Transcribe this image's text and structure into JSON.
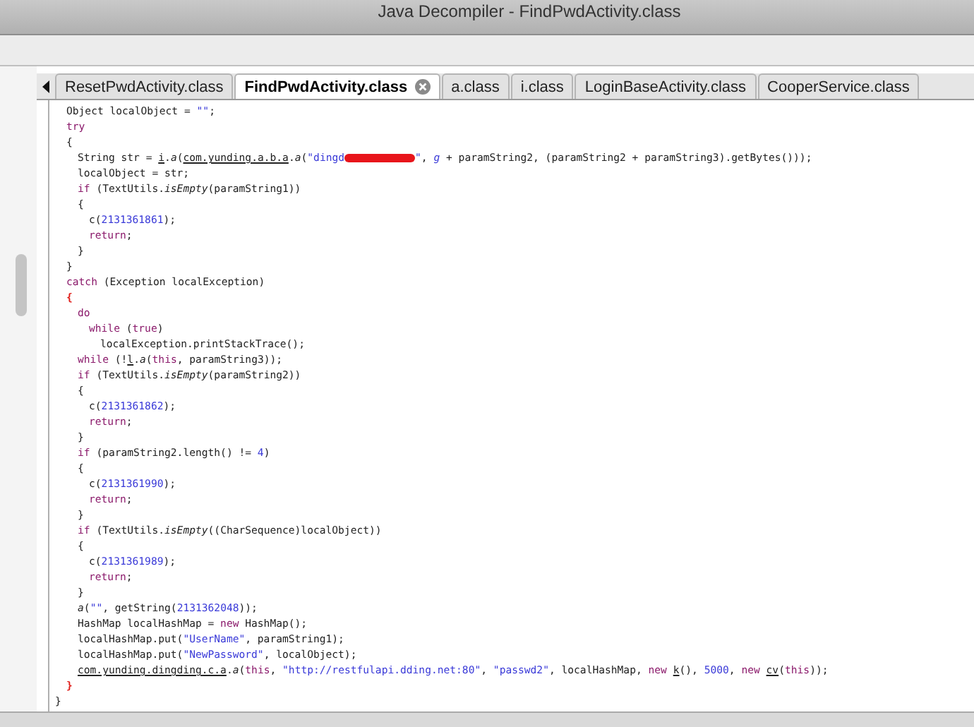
{
  "window": {
    "title": "Java Decompiler - FindPwdActivity.class"
  },
  "tabs": [
    {
      "label": "ResetPwdActivity.class",
      "selected": false
    },
    {
      "label": "FindPwdActivity.class",
      "selected": true
    },
    {
      "label": "a.class",
      "selected": false
    },
    {
      "label": "i.class",
      "selected": false
    },
    {
      "label": "LoginBaseActivity.class",
      "selected": false
    },
    {
      "label": "CooperService.class",
      "selected": false
    }
  ],
  "code": [
    {
      "children": [
        {
          "tokens": [
            {
              "kind": "plain",
              "text": "Object localObject = "
            },
            {
              "kind": "literal",
              "text": "\"\""
            },
            {
              "kind": "plain",
              "text": ";"
            }
          ]
        },
        {
          "tokens": [
            {
              "kind": "keyword",
              "text": "try"
            }
          ]
        },
        {
          "tokens": [
            {
              "kind": "plain",
              "text": "{"
            }
          ],
          "children": [
            {
              "tokens": [
                {
                  "kind": "plain",
                  "text": "String str = "
                },
                {
                  "kind": "link",
                  "text": "i"
                },
                {
                  "kind": "plain",
                  "text": "."
                },
                {
                  "kind": "method",
                  "text": "a"
                },
                {
                  "kind": "plain",
                  "text": "("
                },
                {
                  "kind": "link",
                  "text": "com.yunding.a.b.a"
                },
                {
                  "kind": "plain",
                  "text": "."
                },
                {
                  "kind": "method",
                  "text": "a"
                },
                {
                  "kind": "plain",
                  "text": "("
                },
                {
                  "kind": "literal",
                  "text": "\"dingd"
                },
                {
                  "kind": "redaction"
                },
                {
                  "kind": "literal",
                  "text": "\""
                },
                {
                  "kind": "plain",
                  "text": ", "
                },
                {
                  "kind": "field",
                  "text": "g"
                },
                {
                  "kind": "plain",
                  "text": " + paramString2, (paramString2 + paramString3).getBytes()));"
                }
              ]
            },
            {
              "tokens": [
                {
                  "kind": "plain",
                  "text": "localObject = str;"
                }
              ]
            },
            {
              "tokens": [
                {
                  "kind": "keyword",
                  "text": "if"
                },
                {
                  "kind": "plain",
                  "text": " (TextUtils."
                },
                {
                  "kind": "method",
                  "text": "isEmpty"
                },
                {
                  "kind": "plain",
                  "text": "(paramString1))"
                }
              ]
            },
            {
              "tokens": [
                {
                  "kind": "plain",
                  "text": "{"
                }
              ],
              "children": [
                {
                  "tokens": [
                    {
                      "kind": "plain",
                      "text": "c("
                    },
                    {
                      "kind": "literal",
                      "text": "2131361861"
                    },
                    {
                      "kind": "plain",
                      "text": ");"
                    }
                  ]
                },
                {
                  "tokens": [
                    {
                      "kind": "keyword",
                      "text": "return"
                    },
                    {
                      "kind": "plain",
                      "text": ";"
                    }
                  ]
                }
              ]
            },
            {
              "tokens": [
                {
                  "kind": "plain",
                  "text": "}"
                }
              ]
            }
          ]
        },
        {
          "tokens": [
            {
              "kind": "plain",
              "text": "}"
            }
          ]
        },
        {
          "tokens": [
            {
              "kind": "keyword",
              "text": "catch"
            },
            {
              "kind": "plain",
              "text": " (Exception localException)"
            }
          ]
        },
        {
          "tokens": [
            {
              "kind": "match",
              "text": "{"
            }
          ],
          "children": [
            {
              "tokens": [
                {
                  "kind": "keyword",
                  "text": "do"
                }
              ],
              "children": [
                {
                  "tokens": [
                    {
                      "kind": "keyword",
                      "text": "while"
                    },
                    {
                      "kind": "plain",
                      "text": " ("
                    },
                    {
                      "kind": "keyword",
                      "text": "true"
                    },
                    {
                      "kind": "plain",
                      "text": ")"
                    }
                  ],
                  "children": [
                    {
                      "tokens": [
                        {
                          "kind": "plain",
                          "text": "localException.printStackTrace();"
                        }
                      ]
                    }
                  ]
                }
              ]
            },
            {
              "tokens": [
                {
                  "kind": "keyword",
                  "text": "while"
                },
                {
                  "kind": "plain",
                  "text": " (!"
                },
                {
                  "kind": "link",
                  "text": "l"
                },
                {
                  "kind": "plain",
                  "text": "."
                },
                {
                  "kind": "method",
                  "text": "a"
                },
                {
                  "kind": "plain",
                  "text": "("
                },
                {
                  "kind": "keyword",
                  "text": "this"
                },
                {
                  "kind": "plain",
                  "text": ", paramString3));"
                }
              ]
            },
            {
              "tokens": [
                {
                  "kind": "keyword",
                  "text": "if"
                },
                {
                  "kind": "plain",
                  "text": " (TextUtils."
                },
                {
                  "kind": "method",
                  "text": "isEmpty"
                },
                {
                  "kind": "plain",
                  "text": "(paramString2))"
                }
              ]
            },
            {
              "tokens": [
                {
                  "kind": "plain",
                  "text": "{"
                }
              ],
              "children": [
                {
                  "tokens": [
                    {
                      "kind": "plain",
                      "text": "c("
                    },
                    {
                      "kind": "literal",
                      "text": "2131361862"
                    },
                    {
                      "kind": "plain",
                      "text": ");"
                    }
                  ]
                },
                {
                  "tokens": [
                    {
                      "kind": "keyword",
                      "text": "return"
                    },
                    {
                      "kind": "plain",
                      "text": ";"
                    }
                  ]
                }
              ]
            },
            {
              "tokens": [
                {
                  "kind": "plain",
                  "text": "}"
                }
              ]
            },
            {
              "tokens": [
                {
                  "kind": "keyword",
                  "text": "if"
                },
                {
                  "kind": "plain",
                  "text": " (paramString2.length() != "
                },
                {
                  "kind": "literal",
                  "text": "4"
                },
                {
                  "kind": "plain",
                  "text": ")"
                }
              ]
            },
            {
              "tokens": [
                {
                  "kind": "plain",
                  "text": "{"
                }
              ],
              "children": [
                {
                  "tokens": [
                    {
                      "kind": "plain",
                      "text": "c("
                    },
                    {
                      "kind": "literal",
                      "text": "2131361990"
                    },
                    {
                      "kind": "plain",
                      "text": ");"
                    }
                  ]
                },
                {
                  "tokens": [
                    {
                      "kind": "keyword",
                      "text": "return"
                    },
                    {
                      "kind": "plain",
                      "text": ";"
                    }
                  ]
                }
              ]
            },
            {
              "tokens": [
                {
                  "kind": "plain",
                  "text": "}"
                }
              ]
            },
            {
              "tokens": [
                {
                  "kind": "keyword",
                  "text": "if"
                },
                {
                  "kind": "plain",
                  "text": " (TextUtils."
                },
                {
                  "kind": "method",
                  "text": "isEmpty"
                },
                {
                  "kind": "plain",
                  "text": "((CharSequence)localObject))"
                }
              ]
            },
            {
              "tokens": [
                {
                  "kind": "plain",
                  "text": "{"
                }
              ],
              "children": [
                {
                  "tokens": [
                    {
                      "kind": "plain",
                      "text": "c("
                    },
                    {
                      "kind": "literal",
                      "text": "2131361989"
                    },
                    {
                      "kind": "plain",
                      "text": ");"
                    }
                  ]
                },
                {
                  "tokens": [
                    {
                      "kind": "keyword",
                      "text": "return"
                    },
                    {
                      "kind": "plain",
                      "text": ";"
                    }
                  ]
                }
              ]
            },
            {
              "tokens": [
                {
                  "kind": "plain",
                  "text": "}"
                }
              ]
            },
            {
              "tokens": [
                {
                  "kind": "method",
                  "text": "a"
                },
                {
                  "kind": "plain",
                  "text": "("
                },
                {
                  "kind": "literal",
                  "text": "\"\""
                },
                {
                  "kind": "plain",
                  "text": ", getString("
                },
                {
                  "kind": "literal",
                  "text": "2131362048"
                },
                {
                  "kind": "plain",
                  "text": "));"
                }
              ]
            },
            {
              "tokens": [
                {
                  "kind": "plain",
                  "text": "HashMap localHashMap = "
                },
                {
                  "kind": "keyword",
                  "text": "new"
                },
                {
                  "kind": "plain",
                  "text": " HashMap();"
                }
              ]
            },
            {
              "tokens": [
                {
                  "kind": "plain",
                  "text": "localHashMap.put("
                },
                {
                  "kind": "literal",
                  "text": "\"UserName\""
                },
                {
                  "kind": "plain",
                  "text": ", paramString1);"
                }
              ]
            },
            {
              "tokens": [
                {
                  "kind": "plain",
                  "text": "localHashMap.put("
                },
                {
                  "kind": "literal",
                  "text": "\"NewPassword\""
                },
                {
                  "kind": "plain",
                  "text": ", localObject);"
                }
              ]
            },
            {
              "tokens": [
                {
                  "kind": "link",
                  "text": "com.yunding.dingding.c.a"
                },
                {
                  "kind": "plain",
                  "text": "."
                },
                {
                  "kind": "method",
                  "text": "a"
                },
                {
                  "kind": "plain",
                  "text": "("
                },
                {
                  "kind": "keyword",
                  "text": "this"
                },
                {
                  "kind": "plain",
                  "text": ", "
                },
                {
                  "kind": "literal",
                  "text": "\"http://restfulapi.dding.net:80\""
                },
                {
                  "kind": "plain",
                  "text": ", "
                },
                {
                  "kind": "literal",
                  "text": "\"passwd2\""
                },
                {
                  "kind": "plain",
                  "text": ", localHashMap, "
                },
                {
                  "kind": "keyword",
                  "text": "new "
                },
                {
                  "kind": "link",
                  "text": "k"
                },
                {
                  "kind": "plain",
                  "text": "(), "
                },
                {
                  "kind": "literal",
                  "text": "5000"
                },
                {
                  "kind": "plain",
                  "text": ", "
                },
                {
                  "kind": "keyword",
                  "text": "new "
                },
                {
                  "kind": "link",
                  "text": "cv"
                },
                {
                  "kind": "plain",
                  "text": "("
                },
                {
                  "kind": "keyword",
                  "text": "this"
                },
                {
                  "kind": "plain",
                  "text": "));"
                }
              ]
            }
          ]
        },
        {
          "tokens": [
            {
              "kind": "match",
              "text": "}"
            }
          ]
        }
      ]
    },
    {
      "tokens": [
        {
          "kind": "plain",
          "text": "}"
        }
      ]
    }
  ]
}
